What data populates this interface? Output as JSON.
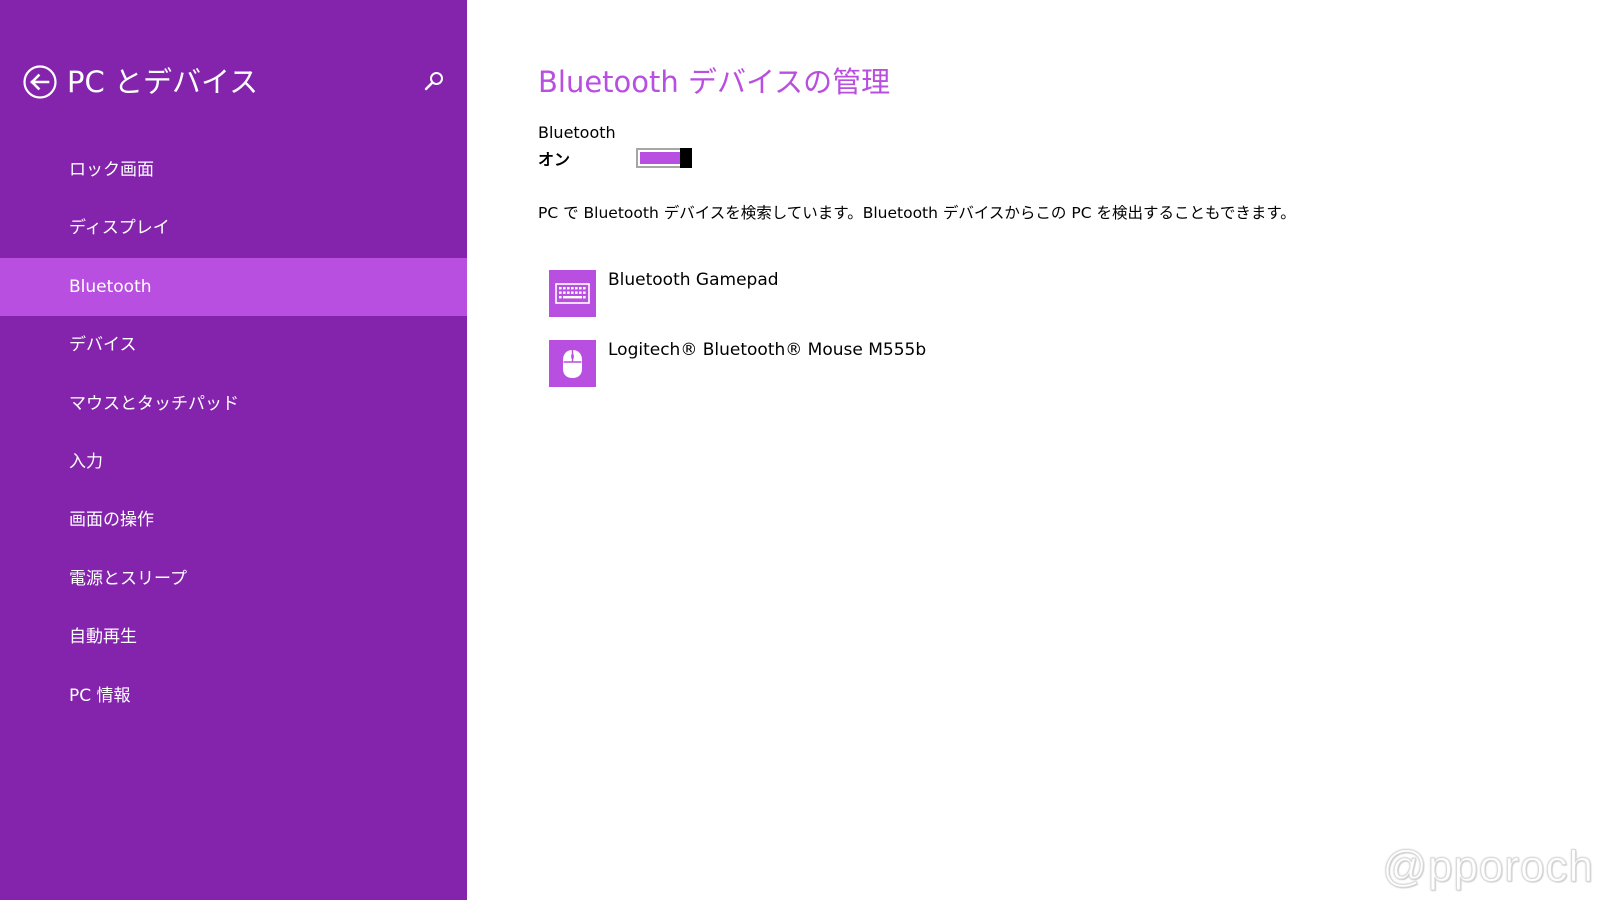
{
  "sidebar": {
    "title": "PC とデバイス",
    "back_icon": "back-arrow-icon",
    "search_icon": "search-icon",
    "items": [
      {
        "label": "ロック画面",
        "active": false
      },
      {
        "label": "ディスプレイ",
        "active": false
      },
      {
        "label": "Bluetooth",
        "active": true
      },
      {
        "label": "デバイス",
        "active": false
      },
      {
        "label": "マウスとタッチパッド",
        "active": false
      },
      {
        "label": "入力",
        "active": false
      },
      {
        "label": "画面の操作",
        "active": false
      },
      {
        "label": "電源とスリープ",
        "active": false
      },
      {
        "label": "自動再生",
        "active": false
      },
      {
        "label": "PC 情報",
        "active": false
      }
    ]
  },
  "main": {
    "title": "Bluetooth デバイスの管理",
    "toggle": {
      "caption": "Bluetooth",
      "state_label": "オン",
      "on": true
    },
    "description": "PC で Bluetooth デバイスを検索しています。Bluetooth デバイスからこの PC を検出することもできます。",
    "devices": [
      {
        "name": "Bluetooth Gamepad",
        "icon": "keyboard-icon"
      },
      {
        "name": "Logitech® Bluetooth® Mouse M555b",
        "icon": "mouse-icon"
      }
    ]
  },
  "watermark": "@pporoch",
  "colors": {
    "sidebar_bg": "#8424ad",
    "sidebar_active": "#b94fe0",
    "accent": "#b94fe0",
    "main_bg": "#ffffff"
  }
}
